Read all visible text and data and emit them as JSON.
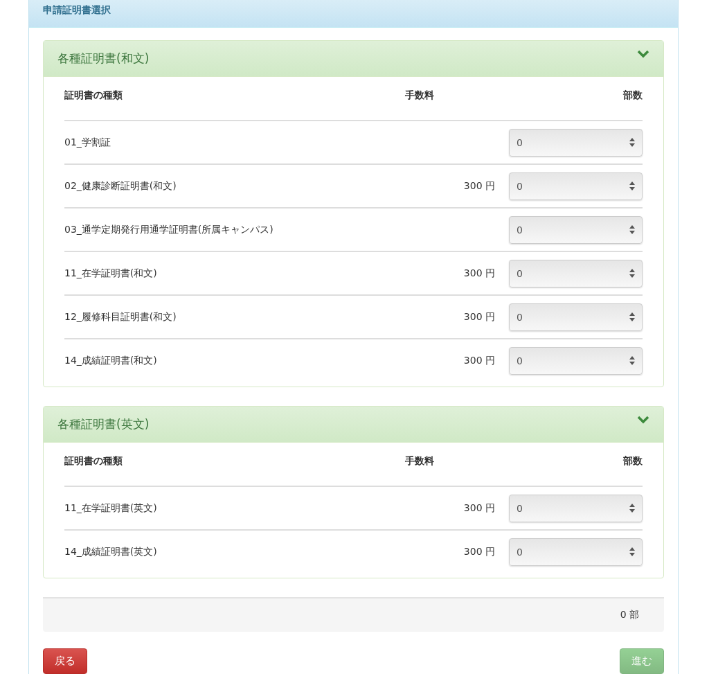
{
  "panel": {
    "title": "申請証明書選択"
  },
  "sections": [
    {
      "title": "各種証明書(和文)",
      "expanded": true,
      "columns": [
        "証明書の種類",
        "手数料",
        "部数"
      ],
      "rows": [
        {
          "name": "01_学割証",
          "fee": "",
          "count": "0"
        },
        {
          "name": "02_健康診断証明書(和文)",
          "fee": "300 円",
          "count": "0"
        },
        {
          "name": "03_通学定期発行用通学証明書(所属キャンパス)",
          "fee": "",
          "count": "0"
        },
        {
          "name": "11_在学証明書(和文)",
          "fee": "300 円",
          "count": "0"
        },
        {
          "name": "12_履修科目証明書(和文)",
          "fee": "300 円",
          "count": "0"
        },
        {
          "name": "14_成績証明書(和文)",
          "fee": "300 円",
          "count": "0"
        }
      ]
    },
    {
      "title": "各種証明書(英文)",
      "expanded": true,
      "columns": [
        "証明書の種類",
        "手数料",
        "部数"
      ],
      "rows": [
        {
          "name": "11_在学証明書(英文)",
          "fee": "300 円",
          "count": "0"
        },
        {
          "name": "14_成績証明書(英文)",
          "fee": "300 円",
          "count": "0"
        }
      ]
    }
  ],
  "total": "0 部",
  "buttons": [
    {
      "label": "戻る",
      "kind": "back",
      "disabled": false
    },
    {
      "label": "進む",
      "kind": "next",
      "disabled": true
    }
  ]
}
